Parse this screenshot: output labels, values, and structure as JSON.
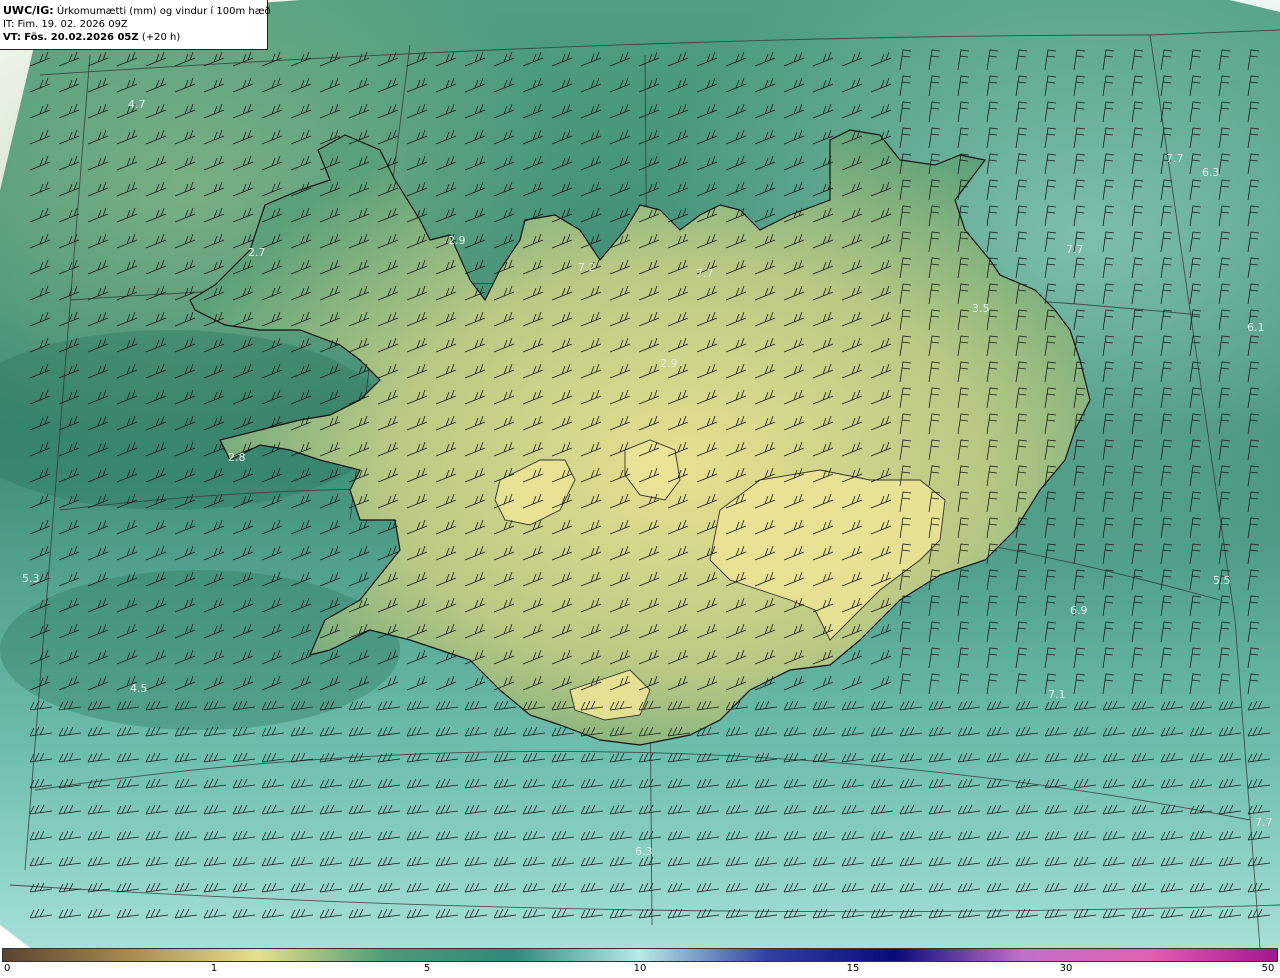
{
  "header": {
    "product": "UWC/IG:",
    "description": "Úrkomumætti (mm) og vindur í 100m hæð",
    "it_label": "IT:",
    "it_value": "Fim. 19. 02. 2026 09Z",
    "vt_label": "VT:",
    "vt_value": "Fös. 20.02.2026 05Z",
    "vt_lead": "(+20 h)"
  },
  "map": {
    "field": "precipitable water (mm)",
    "ocean_color": "#3f9a86",
    "land_color_low": "#d6dd92",
    "coast_color": "#111111",
    "grid_color": "#333333",
    "labels": [
      "4.7",
      "2.7",
      "2.9",
      "7.2",
      "7.7",
      "3.5",
      "7.7",
      "6.3",
      "7.7",
      "6.1",
      "2.9",
      "2.8",
      "5.3",
      "4.5",
      "6.9",
      "5.5",
      "7.1",
      "7.7",
      "6.3"
    ]
  },
  "colorbar": {
    "ticks": [
      "0",
      "1",
      "5",
      "10",
      "15",
      "30",
      "50"
    ],
    "stops": [
      "#5a4430",
      "#a88a52",
      "#e6e08c",
      "#4f9a78",
      "#2f8a7a",
      "#b8eae6",
      "#3040a0",
      "#0a0a7a",
      "#c070c8",
      "#e060b0",
      "#a01890"
    ]
  }
}
